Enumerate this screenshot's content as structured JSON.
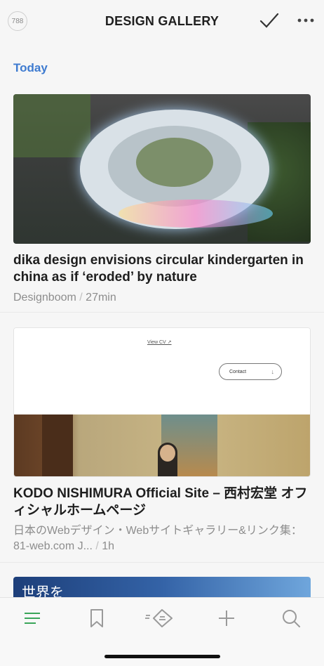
{
  "header": {
    "badge_count": "788",
    "title": "DESIGN GALLERY",
    "icons": {
      "check": "check-icon",
      "more": "more-icon"
    }
  },
  "section": {
    "label": "Today"
  },
  "articles": [
    {
      "headline": "dika design envisions circular kindergarten in china as if ‘eroded’ by nature",
      "source": "Designboom",
      "age": "27min"
    },
    {
      "headline": "KODO NISHIMURA Official Site – 西村宏堂 オフィシャルホームページ",
      "source": "日本のWebデザイン・Webサイトギャラリー&リンク集：81-web.com J...",
      "age": "1h",
      "thumb": {
        "view_cv": "View CV ↗",
        "contact": "Contact",
        "contact_arrow": "↓"
      }
    },
    {
      "thumb_text": "世界を"
    }
  ],
  "tabs": [
    {
      "name": "feed",
      "icon": "menu-icon",
      "active": true
    },
    {
      "name": "saved",
      "icon": "bookmark-icon"
    },
    {
      "name": "explore",
      "icon": "tag-icon"
    },
    {
      "name": "add",
      "icon": "plus-icon"
    },
    {
      "name": "search",
      "icon": "search-icon"
    }
  ],
  "colors": {
    "accent_blue": "#3e7bd0",
    "active_green": "#3aa55a",
    "icon_gray": "#9a9a9a"
  }
}
